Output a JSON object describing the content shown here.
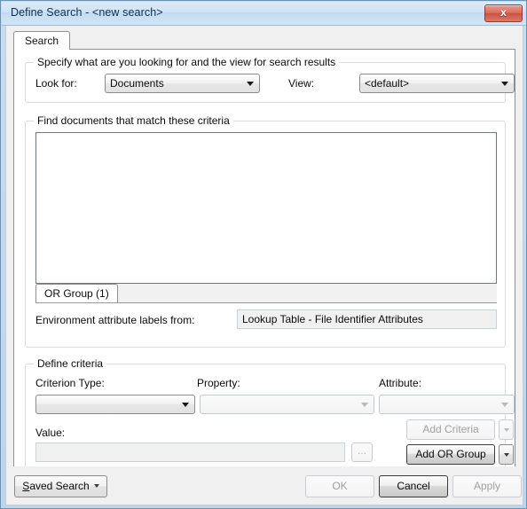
{
  "window": {
    "title": "Define Search - <new search>",
    "close_button_glyph": "x",
    "frame_color": "#c9dcee",
    "titlebar_text_color": "#0d2c55",
    "close_button_color": "#c8503f"
  },
  "tabs": [
    {
      "label": "Search",
      "selected": true
    }
  ],
  "specify_group": {
    "legend": "Specify what are you looking for and the view for search results",
    "look_for": {
      "label": "Look for:",
      "value": "Documents",
      "options": [
        "Documents"
      ]
    },
    "view": {
      "label": "View:",
      "value": "<default>",
      "options": [
        "<default>"
      ]
    }
  },
  "criteria_group": {
    "legend": "Find documents that match these criteria",
    "list_items": [],
    "or_group_tabs": [
      {
        "label": "OR Group (1)",
        "selected": true
      }
    ],
    "environment_labels": {
      "label": "Environment attribute labels from:",
      "value": "Lookup Table - File Identifier Attributes"
    }
  },
  "define_criteria_group": {
    "legend": "Define criteria",
    "criterion_type": {
      "label": "Criterion Type:",
      "value": "",
      "enabled": true
    },
    "property": {
      "label": "Property:",
      "value": "",
      "enabled": false
    },
    "attribute": {
      "label": "Attribute:",
      "value": "",
      "enabled": false
    },
    "value_field": {
      "label": "Value:",
      "value": "",
      "enabled": false
    },
    "browse_button": {
      "label": "...",
      "enabled": false
    },
    "add_criteria_button": {
      "label": "Add Criteria",
      "enabled": false
    },
    "add_or_group_button": {
      "label": "Add OR Group",
      "enabled": true
    }
  },
  "footer": {
    "saved_search": {
      "label_accel": "S",
      "label_rest": "aved Search"
    },
    "ok": {
      "label": "OK",
      "enabled": false
    },
    "cancel": {
      "label": "Cancel",
      "enabled": true,
      "is_default": true
    },
    "apply": {
      "label": "Apply",
      "enabled": false
    }
  }
}
